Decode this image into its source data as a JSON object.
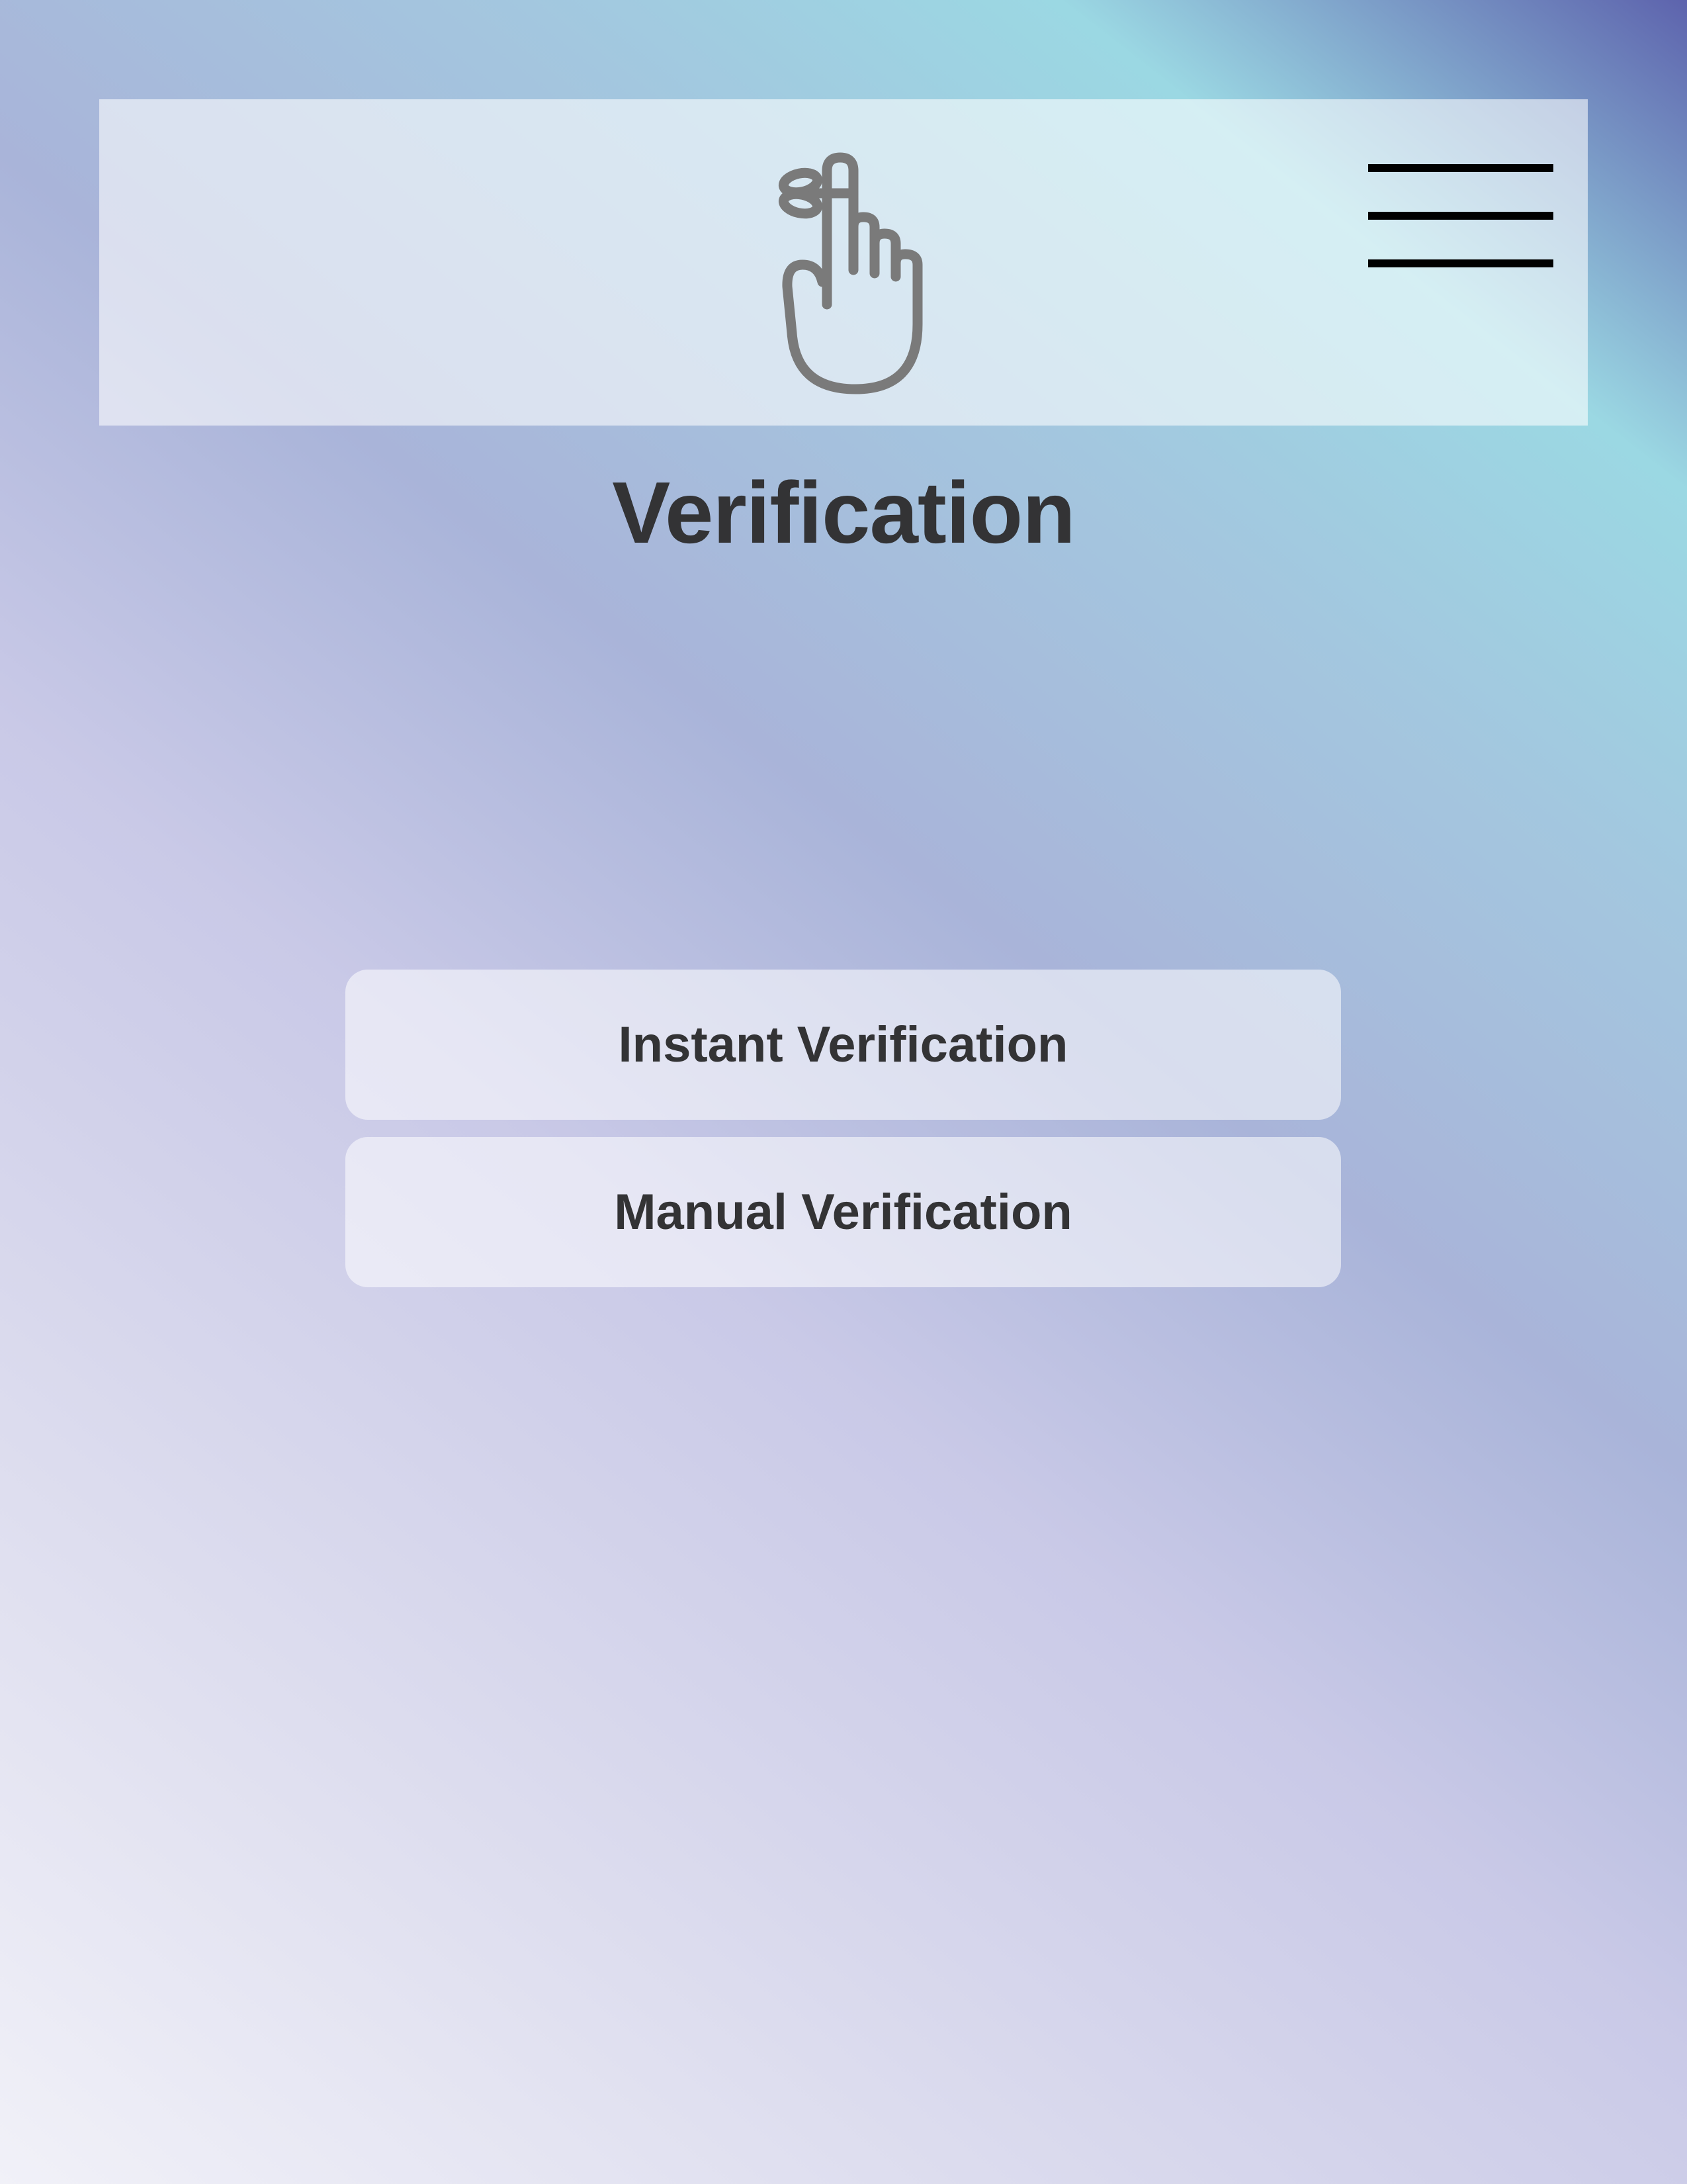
{
  "header": {
    "logo_icon": "finger-ribbon-reminder-icon",
    "menu_icon": "hamburger-menu-icon"
  },
  "page": {
    "title": "Verification"
  },
  "options": [
    {
      "label": "Instant Verification"
    },
    {
      "label": "Manual Verification"
    }
  ],
  "colors": {
    "text": "#333335",
    "icon": "#7a7a7a",
    "menu_bars": "#000000"
  }
}
